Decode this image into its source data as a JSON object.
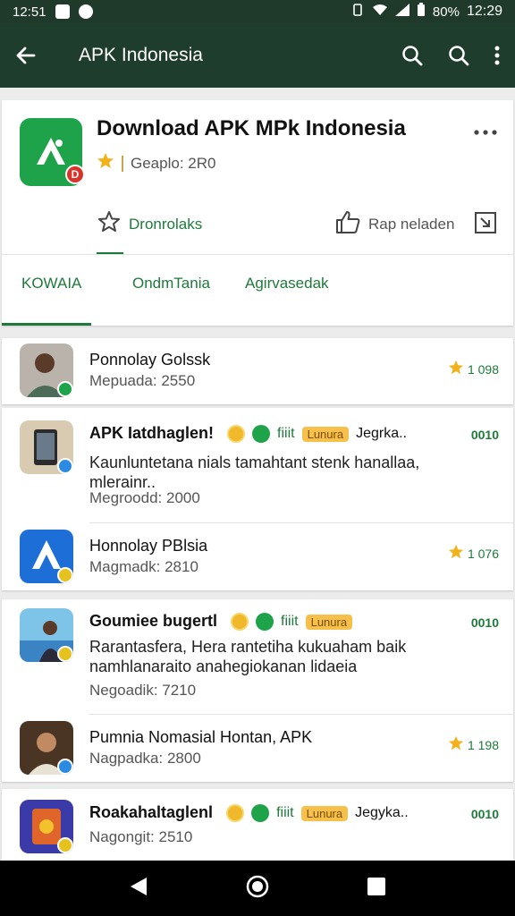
{
  "status_bar": {
    "left_text": "12:51",
    "battery": "80%",
    "time": "12:29"
  },
  "app_bar": {
    "title": "APK Indonesia"
  },
  "header": {
    "app_title": "Download APK MPk Indonesia",
    "subtitle": "Geaplo: 2R0",
    "download_label": "Dronrolaks",
    "rate_label": "Rap neladen",
    "tabs": [
      "KOWAIA",
      "OndmTania",
      "Agirvasedak"
    ]
  },
  "items": [
    {
      "title": "Ponnolay Golssk",
      "sub": "Mepuada: 2550",
      "rating": "1 098"
    },
    {
      "title": "APK Iatdhaglen!",
      "fiit": "fiiit",
      "tag": "Lunura",
      "extra": "Jegrka..",
      "code": "0010",
      "desc": "Kaunluntetana nials tamahtant stenk hanallaa, mlerainr..",
      "sub": "Megroodd: 2000"
    },
    {
      "title": "Honnolay PBlsia",
      "sub": "Magmadk: 2810",
      "rating": "1 076"
    },
    {
      "title": "Goumiee bugertl",
      "fiit": "fiiit",
      "tag": "Lunura",
      "code": "0010",
      "desc": "Rarantasfera, Hera rantetiha kukuaham baik namhlanaraito anahegiokanan lidaeia",
      "sub": "Negoadik: 7210"
    },
    {
      "title": "Pumnia Nomasial Hontan, APK",
      "sub": "Nagpadka: 2800",
      "rating": "1 198"
    },
    {
      "title": "Roakahaltaglenl",
      "fiit": "fiiit",
      "tag": "Lunura",
      "extra": "Jegyka..",
      "code": "0010",
      "sub": "Nagongit: 2510"
    }
  ],
  "colors": {
    "app_bar": "#1e3d2d",
    "accent": "#1e7a3a",
    "star": "#f2b21b",
    "tag": "#f7c04a"
  },
  "icons": {
    "back": "arrow-left-icon",
    "search": "search-icon",
    "menu": "more-vert-icon",
    "star": "star-icon",
    "thumbs_up": "thumbs-up-icon",
    "share": "share-icon"
  }
}
